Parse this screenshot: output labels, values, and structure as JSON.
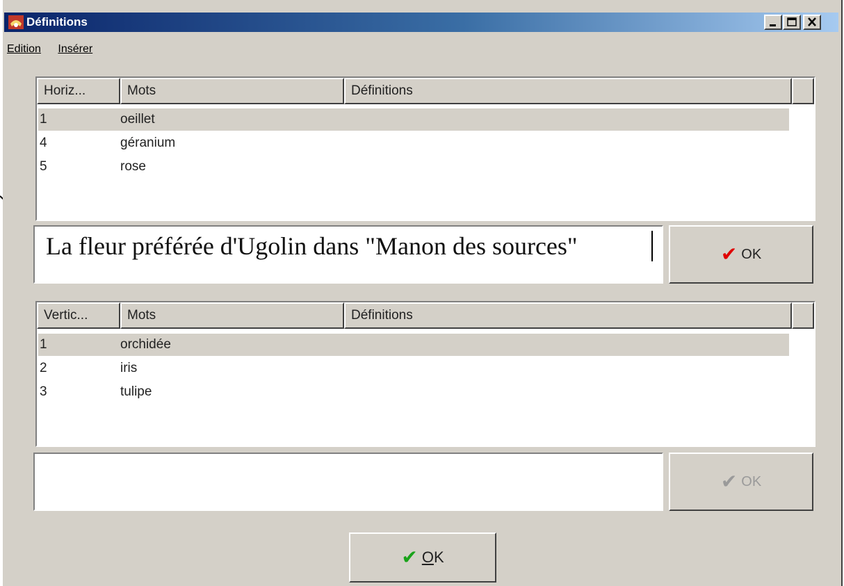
{
  "window": {
    "title": "Définitions"
  },
  "menu": {
    "edition": "Edition",
    "inserer": "Insérer"
  },
  "horizontal_list": {
    "columns": [
      "Horiz...",
      "Mots",
      "Définitions"
    ],
    "rows": [
      {
        "num": "1",
        "word": "oeillet",
        "selected": true
      },
      {
        "num": "4",
        "word": "géranium",
        "selected": false
      },
      {
        "num": "5",
        "word": "rose",
        "selected": false
      }
    ]
  },
  "definition_input_1": {
    "value": "La fleur préférée d'Ugolin dans \"Manon des sources\""
  },
  "ok_button_1": {
    "label": "OK"
  },
  "vertical_list": {
    "columns": [
      "Vertic...",
      "Mots",
      "Définitions"
    ],
    "rows": [
      {
        "num": "1",
        "word": "orchidée",
        "selected": true
      },
      {
        "num": "2",
        "word": "iris",
        "selected": false
      },
      {
        "num": "3",
        "word": "tulipe",
        "selected": false
      }
    ]
  },
  "definition_input_2": {
    "value": ""
  },
  "ok_button_2": {
    "label": "OK"
  },
  "main_ok_button": {
    "label_underlined": "O",
    "label_rest": "K"
  },
  "colors": {
    "title_start": "#0a246a",
    "title_end": "#a6caf0",
    "check_red": "#e00000",
    "check_green": "#1aa31a",
    "face": "#d4d0c8"
  },
  "icons": {
    "app": "app-logo-icon",
    "minimize": "minimize-icon",
    "maximize": "maximize-icon",
    "close": "close-icon",
    "check": "checkmark-icon"
  }
}
